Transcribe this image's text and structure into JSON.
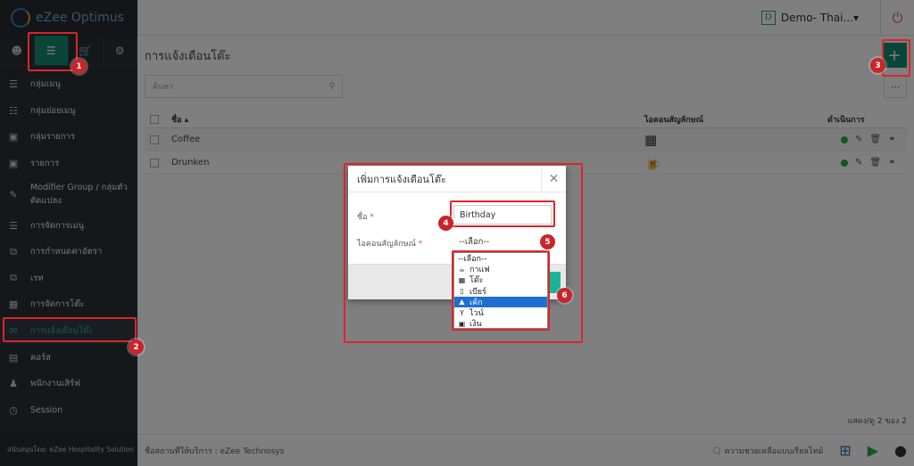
{
  "app": {
    "brand": "eZee Optimus"
  },
  "sidebar": {
    "tabs": [
      {
        "icon": "user-icon"
      },
      {
        "icon": "menu-icon"
      },
      {
        "icon": "cart-icon"
      },
      {
        "icon": "gear-icon"
      }
    ],
    "items": [
      {
        "label": "กลุ่มเมนู",
        "icon": "list-icon"
      },
      {
        "label": "กลุ่มย่อยเมนู",
        "icon": "sublist-icon"
      },
      {
        "label": "กลุ่มรายการ",
        "icon": "cube-icon"
      },
      {
        "label": "รายการ",
        "icon": "cube-icon"
      },
      {
        "label": "Modifier Group / กลุ่มตัวดัดแปลง",
        "icon": "edit-icon"
      },
      {
        "label": "การจัดการเมนู",
        "icon": "list-icon"
      },
      {
        "label": "การกำหนดค่าอัตรา",
        "icon": "copy-icon"
      },
      {
        "label": "เรท",
        "icon": "copy-icon"
      },
      {
        "label": "การจัดการโต๊ะ",
        "icon": "grid-icon"
      },
      {
        "label": "การแจ้งเตือนโต๊ะ",
        "icon": "chat-icon"
      },
      {
        "label": "คอร์ส",
        "icon": "book-icon"
      },
      {
        "label": "พนักงานเสิร์ฟ",
        "icon": "person-icon"
      },
      {
        "label": "Session",
        "icon": "clock-icon"
      }
    ],
    "footer": "สนับสนุนโดย: eZee Hospitality Solution"
  },
  "header": {
    "business_badge": "D",
    "business_name": "Demo- Thai...▾"
  },
  "main": {
    "title": "การแจ้งเตือนโต๊ะ",
    "search_placeholder": "ค้นหา",
    "columns": {
      "name": "ชื่อ ▴",
      "icon": "ไอคอนสัญลักษณ์",
      "action": "ดำเนินการ"
    },
    "rows": [
      {
        "name": "Coffee",
        "icon": "table-icon",
        "status_color": "#2aa84a"
      },
      {
        "name": "Drunken",
        "icon": "beer-icon",
        "status_color": "#2aa84a"
      }
    ],
    "pager": "แสดง/ดู 2 ของ 2"
  },
  "footer": {
    "support": "ชื่อสถานที่ให้บริการ : eZee Technosys",
    "help": "ความช่วยเหลือแบบเรียลไทม์"
  },
  "modal": {
    "title": "เพิ่มการแจ้งเตือนโต๊ะ",
    "name_label": "ชื่อ",
    "name_value": "Birthday",
    "icon_label": "ไอคอนสัญลักษณ์",
    "select_value": "--เลือก--",
    "required_mark": "*"
  },
  "dropdown": {
    "options": [
      {
        "label": "--เลือก--",
        "icon": "",
        "selected": false
      },
      {
        "label": "กาแฟ",
        "icon": "coffee-icon",
        "selected": false
      },
      {
        "label": "โต๊ะ",
        "icon": "table-icon",
        "selected": false
      },
      {
        "label": "เบียร์",
        "icon": "beer-icon",
        "selected": false
      },
      {
        "label": "เค้ก",
        "icon": "cake-icon",
        "selected": true
      },
      {
        "label": "ไวน์",
        "icon": "wine-icon",
        "selected": false
      },
      {
        "label": "เงิน",
        "icon": "money-icon",
        "selected": false
      }
    ]
  },
  "annotations": {
    "badges": [
      "1",
      "2",
      "3",
      "4",
      "5",
      "6"
    ],
    "color": "#d9262b"
  }
}
